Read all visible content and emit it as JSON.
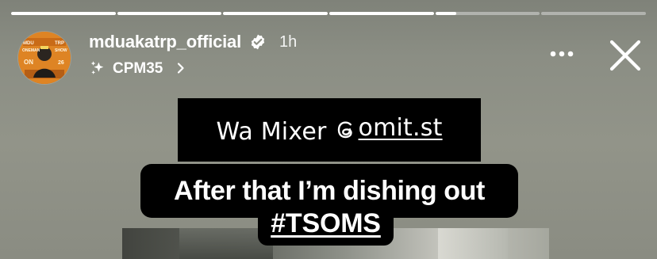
{
  "progress_segments": [
    {
      "fill": 1.0
    },
    {
      "fill": 1.0
    },
    {
      "fill": 1.0
    },
    {
      "fill": 1.0
    },
    {
      "fill": 0.2
    },
    {
      "fill": 0.0
    }
  ],
  "account": {
    "username": "mduakatrp_official",
    "verified": true,
    "time": "1h",
    "avatar_text_left": "MDU",
    "avatar_text_right": "TRP",
    "avatar_text_mid_left": "ONEMAN",
    "avatar_text_mid_right": "SHOW",
    "avatar_text_bottom_left": "ON",
    "avatar_text_bottom_right": "26"
  },
  "subheader": {
    "label": "CPM35",
    "icon": "sparkle-icon",
    "chevron": "chevron-right-icon"
  },
  "controls": {
    "more_icon": "more-horizontal-icon",
    "close_icon": "close-icon"
  },
  "captions": {
    "top_line_prefix": "Wa Mixer",
    "top_line_mention_icon": "threads-icon",
    "top_line_mention": "omit.st",
    "main_line": "After that I’m dishing out",
    "hashtag": "#TSOMS"
  },
  "colors": {
    "background": "#8d8f85",
    "caption_box": "#000000",
    "text": "#ffffff",
    "avatar_orange": "#da7d1f"
  }
}
